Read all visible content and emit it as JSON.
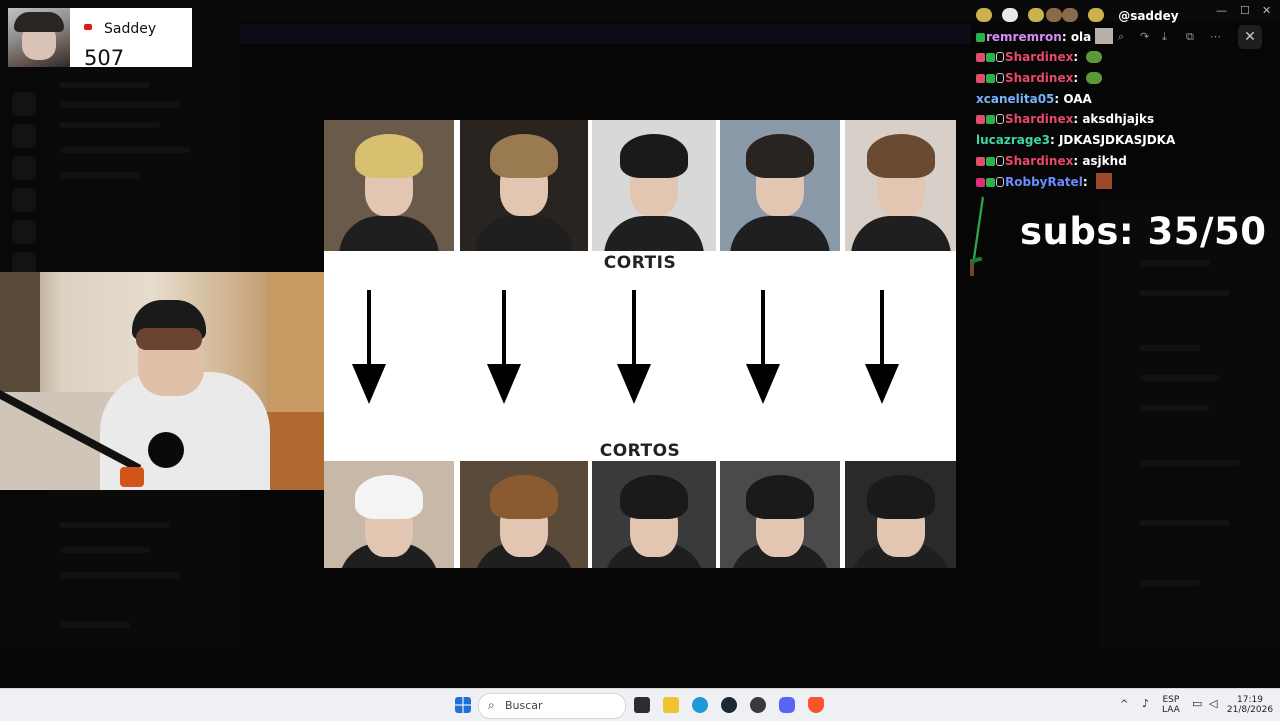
{
  "follower_card": {
    "name": "Saddey",
    "count": "507"
  },
  "chat": {
    "header": "@saddey",
    "messages": [
      {
        "user": "remremron",
        "color": "#d88cf5",
        "text": "ola",
        "badges": [
          "green"
        ],
        "emote": "pic"
      },
      {
        "user": "Shardinex",
        "color": "#e8496a",
        "text": "",
        "badges": [
          "heart",
          "green",
          "ring"
        ],
        "emote": "pepe"
      },
      {
        "user": "Shardinex",
        "color": "#e8496a",
        "text": "",
        "badges": [
          "heart",
          "green",
          "ring"
        ],
        "emote": "pepe"
      },
      {
        "user": "xcanelita05",
        "color": "#7ab0ff",
        "text": "OAA",
        "badges": [],
        "emote": ""
      },
      {
        "user": "Shardinex",
        "color": "#e8496a",
        "text": "aksdhjajks",
        "badges": [
          "heart",
          "green",
          "ring"
        ],
        "emote": ""
      },
      {
        "user": "lucazrage3",
        "color": "#3fd6a0",
        "text": "JDKASJDKASJDKA",
        "badges": [],
        "emote": ""
      },
      {
        "user": "Shardinex",
        "color": "#e8496a",
        "text": "asjkhd",
        "badges": [
          "heart",
          "green",
          "ring"
        ],
        "emote": ""
      },
      {
        "user": "RobbyRatel",
        "color": "#6a8cff",
        "text": "",
        "badges": [
          "pink",
          "green",
          "ring"
        ],
        "emote": "red"
      }
    ]
  },
  "subs": {
    "label": "subs: 35/50"
  },
  "slide": {
    "top_label": "CORTIS",
    "bottom_label": "CORTOS",
    "arrows": 5
  },
  "taskbar": {
    "search_placeholder": "Buscar",
    "lang_top": "ESP",
    "lang_bottom": "LAA",
    "time": "17:19",
    "date": "21/8/2026"
  },
  "colors": {
    "slide_bg": "#ffffff",
    "chat_text": "#ffffff",
    "taskbar_bg": "#eef0f4"
  }
}
